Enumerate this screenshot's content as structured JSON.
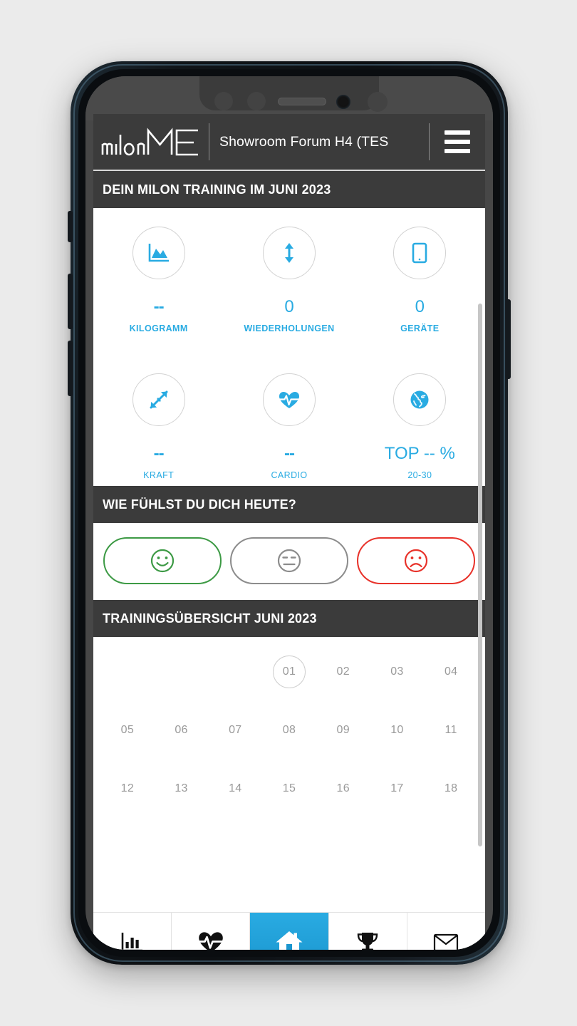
{
  "app": {
    "brand_logo": "milon ME",
    "brand_primary": "milon",
    "brand_secondary": "ME",
    "title": "Showroom Forum H4 (TES",
    "menu_icon": "hamburger-menu-icon",
    "accent_color": "#29abe2",
    "header_bg": "#3b3b3b"
  },
  "training_section": {
    "heading": "DEIN MILON TRAINING IM JUNI 2023",
    "stats": [
      {
        "icon": "area-chart-icon",
        "value": "--",
        "label": "KILOGRAMM"
      },
      {
        "icon": "arrows-vertical-icon",
        "value": "0",
        "label": "WIEDERHOLUNGEN"
      },
      {
        "icon": "tablet-device-icon",
        "value": "0",
        "label": "GERÄTE"
      },
      {
        "icon": "compress-arrows-icon",
        "value": "--",
        "label": "KRAFT"
      },
      {
        "icon": "heartbeat-icon",
        "value": "--",
        "label": "CARDIO"
      },
      {
        "icon": "globe-icon",
        "value": "TOP -- %",
        "label": "20-30"
      }
    ]
  },
  "mood_section": {
    "heading": "WIE FÜHLST DU DICH HEUTE?",
    "options": [
      {
        "icon": "smiley-happy-icon",
        "name": "good",
        "color": "#3d9a45"
      },
      {
        "icon": "smiley-neutral-icon",
        "name": "neutral",
        "color": "#8c8c8c"
      },
      {
        "icon": "smiley-sad-icon",
        "name": "bad",
        "color": "#e8322a"
      }
    ]
  },
  "calendar_section": {
    "heading": "TRAININGSÜBERSICHT JUNI 2023",
    "leading_blanks": 3,
    "today": "01",
    "days": [
      "01",
      "02",
      "03",
      "04",
      "05",
      "06",
      "07",
      "08",
      "09",
      "10",
      "11",
      "12",
      "13",
      "14",
      "15",
      "16",
      "17",
      "18"
    ]
  },
  "bottom_nav": {
    "items": [
      {
        "icon": "bar-chart-icon",
        "name": "statistics",
        "active": false
      },
      {
        "icon": "heartbeat-icon",
        "name": "health",
        "active": false
      },
      {
        "icon": "home-icon",
        "name": "home",
        "active": true
      },
      {
        "icon": "trophy-icon",
        "name": "achievements",
        "active": false
      },
      {
        "icon": "envelope-icon",
        "name": "messages",
        "active": false
      }
    ]
  }
}
